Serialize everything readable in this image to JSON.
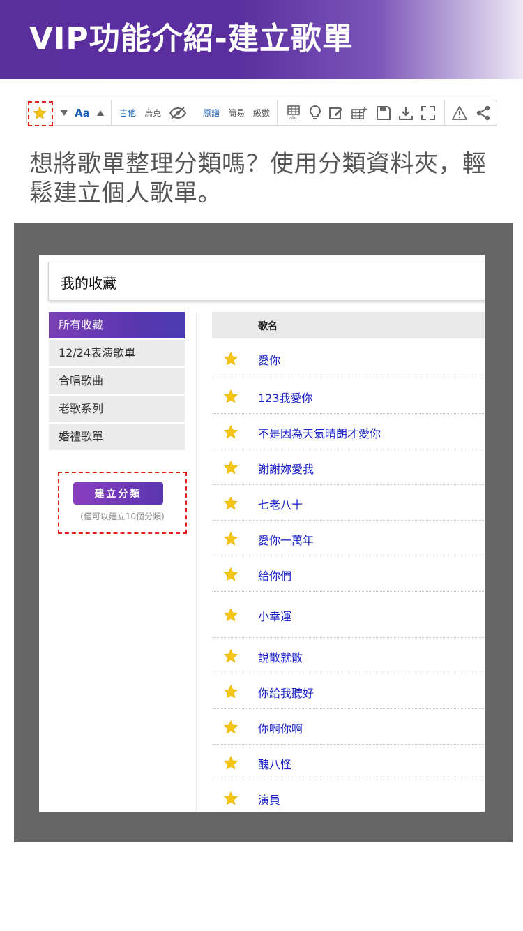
{
  "header": {
    "title": "VIP功能介紹-建立歌單"
  },
  "toolbar": {
    "items": [
      {
        "kind": "icon",
        "icon": "star-icon"
      },
      {
        "kind": "icon",
        "icon": "triangle-down-icon"
      },
      {
        "kind": "text",
        "label": "Aa"
      },
      {
        "kind": "icon",
        "icon": "triangle-up-icon"
      },
      {
        "kind": "text",
        "label": "吉他"
      },
      {
        "kind": "text",
        "label": "烏克"
      },
      {
        "kind": "icon",
        "icon": "eye-slash-icon"
      },
      {
        "kind": "text",
        "label": "原譜"
      },
      {
        "kind": "text",
        "label": "簡易"
      },
      {
        "kind": "text",
        "label": "級數"
      },
      {
        "kind": "icon",
        "icon": "grid-abc-icon",
        "label": "abc"
      },
      {
        "kind": "icon",
        "icon": "lightbulb-icon"
      },
      {
        "kind": "icon",
        "icon": "edit-icon"
      },
      {
        "kind": "icon",
        "icon": "table-add-icon"
      },
      {
        "kind": "icon",
        "icon": "save-icon"
      },
      {
        "kind": "icon",
        "icon": "download-icon"
      },
      {
        "kind": "icon",
        "icon": "fullscreen-icon"
      },
      {
        "kind": "icon",
        "icon": "warning-icon"
      },
      {
        "kind": "icon",
        "icon": "share-icon"
      }
    ]
  },
  "intro": {
    "text": "想將歌單整理分類嗎？使用分類資料夾，輕鬆建立個人歌單。"
  },
  "favorites": {
    "title": "我的收藏",
    "categories": [
      "所有收藏",
      "12/24表演歌單",
      "合唱歌曲",
      "老歌系列",
      "婚禮歌單"
    ],
    "active_category": "所有收藏",
    "create_button": "建立分類",
    "create_note": "(僅可以建立10個分類)",
    "list_header": "歌名",
    "songs": [
      "愛你",
      "123我愛你",
      "不是因為天氣晴朗才愛你",
      "謝謝妳愛我",
      "七老八十",
      "愛你一萬年",
      "給你們",
      "小幸運",
      "說散就散",
      "你給我聽好",
      "你啊你啊",
      "醜八怪",
      "演員"
    ]
  },
  "colors": {
    "brand_purple": "#5b2e9e",
    "link_blue": "#1a22c8",
    "toolbar_blue": "#1a5fb4",
    "highlight_red": "#e0201b",
    "star_yellow": "#f5c518",
    "frame_gray": "#666666"
  }
}
